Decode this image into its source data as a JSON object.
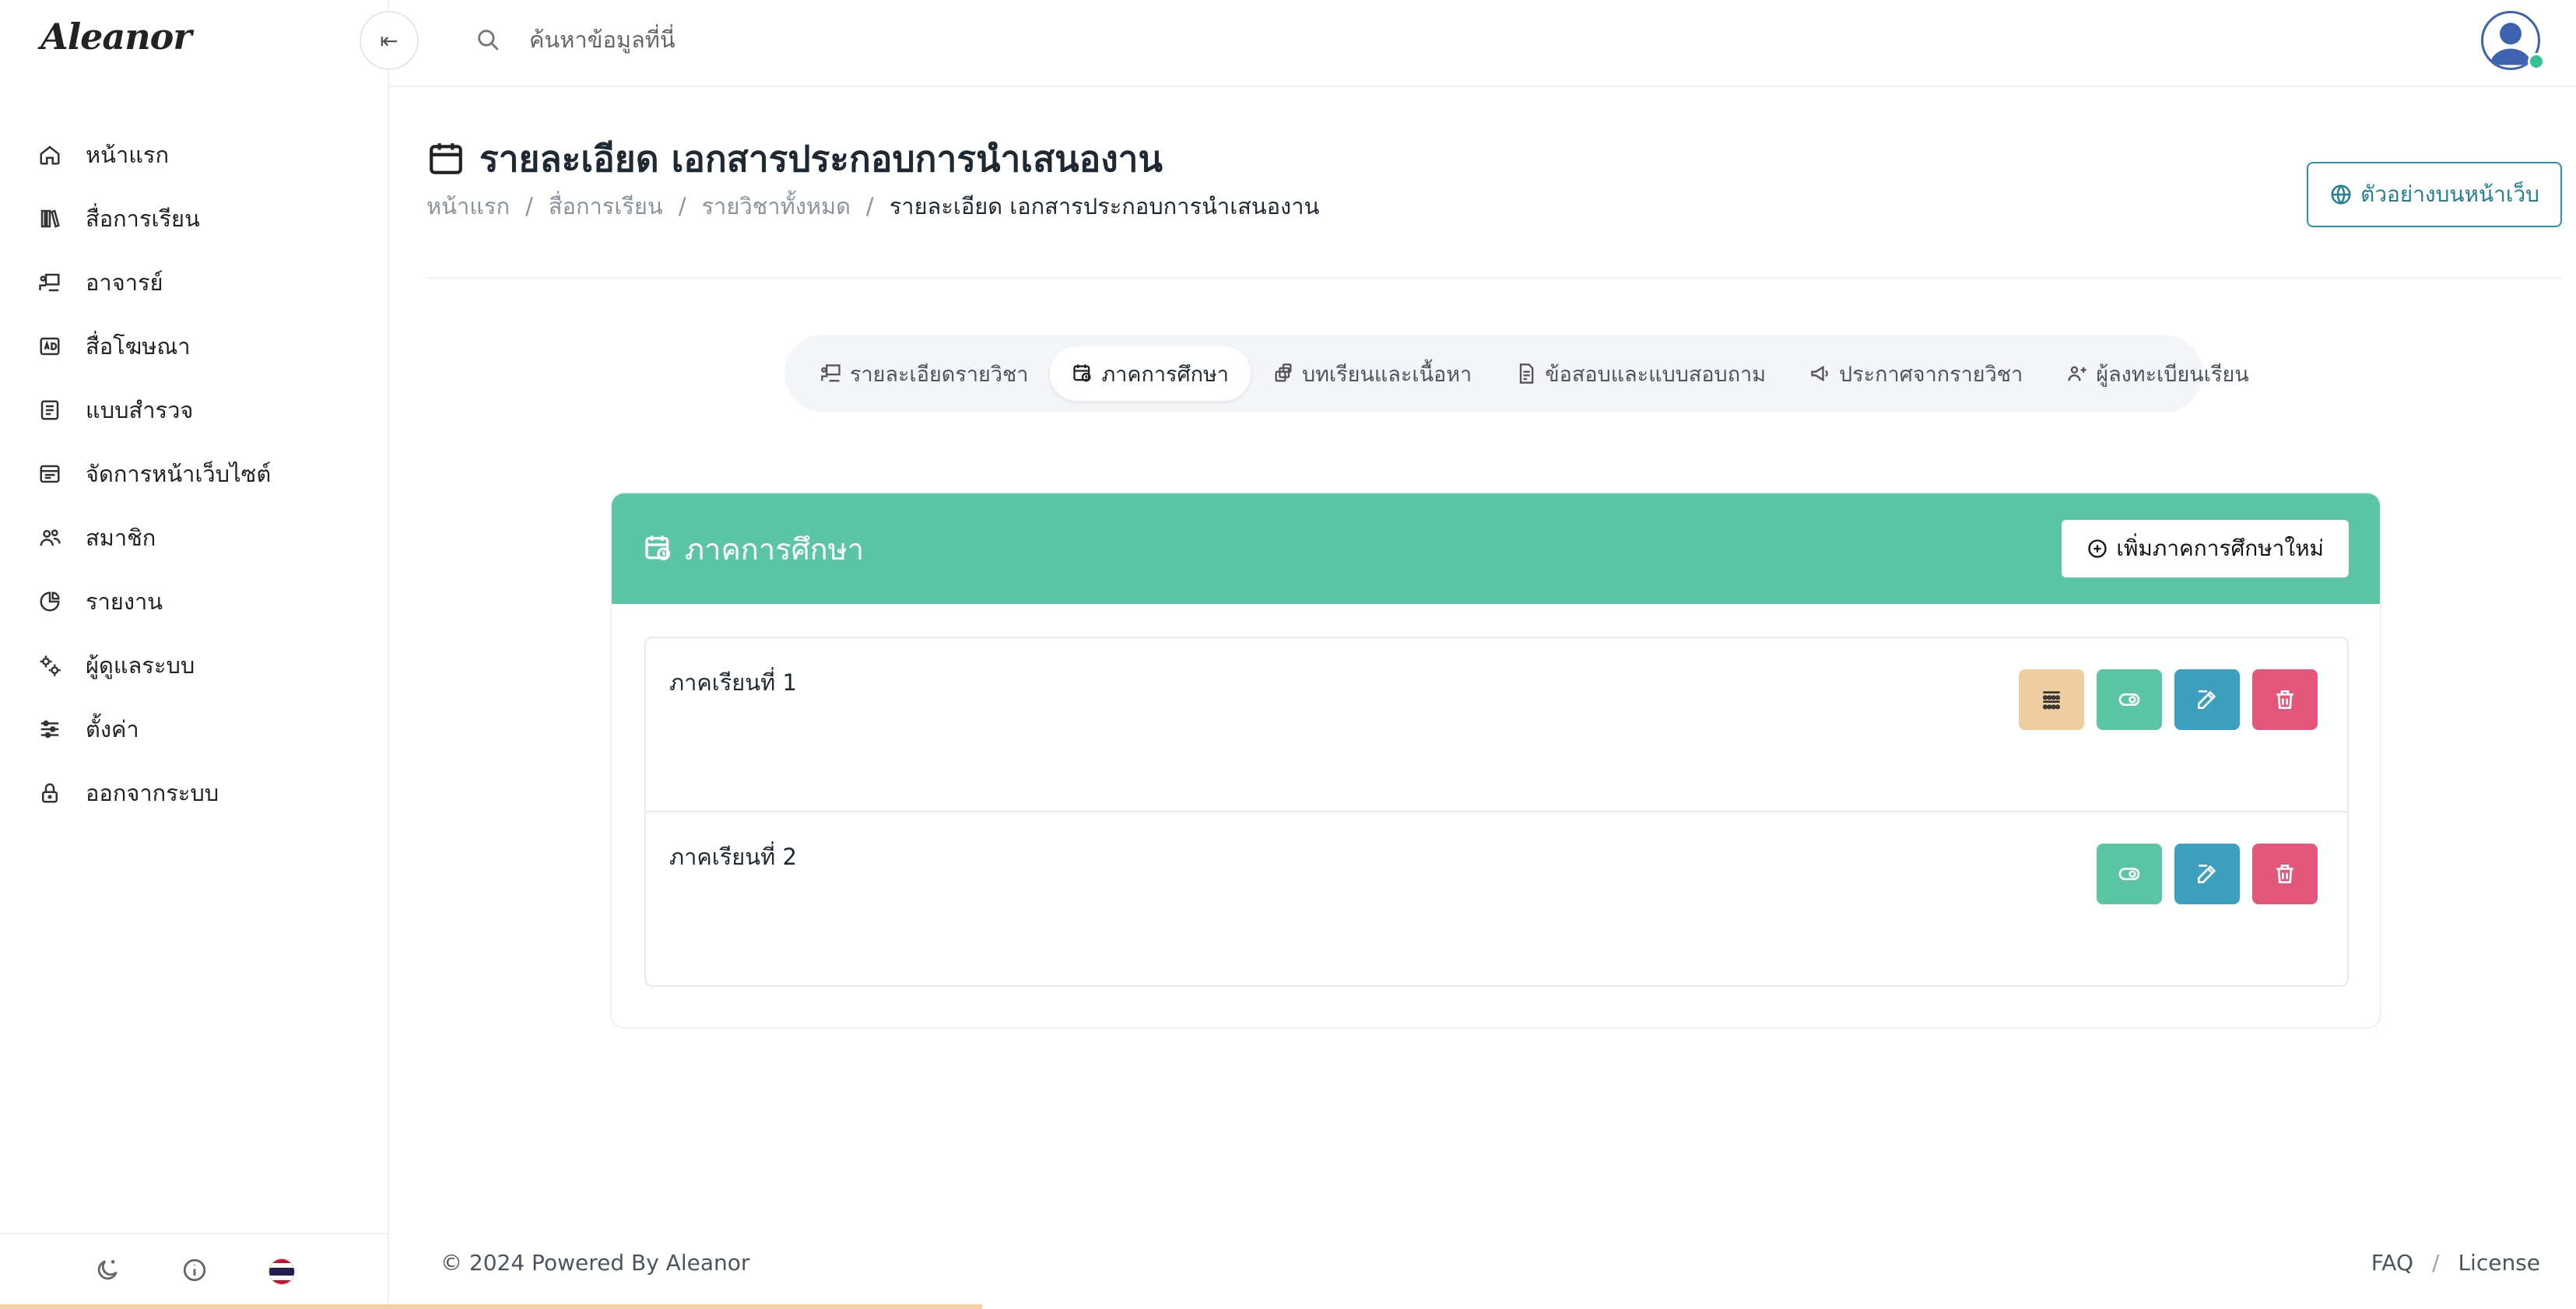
{
  "app": {
    "logo": "Aleanor",
    "collapse_icon": "collapse-left-icon"
  },
  "search": {
    "placeholder": "ค้นหาข้อมูลที่นี่",
    "value": ""
  },
  "sidebar": {
    "items": [
      {
        "label": "หน้าแรก",
        "icon": "home-icon"
      },
      {
        "label": "สื่อการเรียน",
        "icon": "books-icon"
      },
      {
        "label": "อาจารย์",
        "icon": "teacher-icon"
      },
      {
        "label": "สื่อโฆษณา",
        "icon": "ad-icon"
      },
      {
        "label": "แบบสำรวจ",
        "icon": "survey-icon"
      },
      {
        "label": "จัดการหน้าเว็บไซต์",
        "icon": "browser-icon"
      },
      {
        "label": "สมาชิก",
        "icon": "users-icon"
      },
      {
        "label": "รายงาน",
        "icon": "pie-chart-icon"
      },
      {
        "label": "ผู้ดูแลระบบ",
        "icon": "gears-icon"
      },
      {
        "label": "ตั้งค่า",
        "icon": "sliders-icon"
      },
      {
        "label": "ออกจากระบบ",
        "icon": "lock-icon"
      }
    ],
    "footer_icons": [
      "moon-icon",
      "info-icon",
      "thai-flag-icon"
    ]
  },
  "page": {
    "title": "รายละเอียด เอกสารประกอบการนำเสนองาน",
    "breadcrumb": [
      "หน้าแรก",
      "สื่อการเรียน",
      "รายวิชาทั้งหมด",
      "รายละเอียด เอกสารประกอบการนำเสนองาน"
    ],
    "preview_button": "ตัวอย่างบนหน้าเว็บ"
  },
  "tabs": [
    {
      "label": "รายละเอียดรายวิชา",
      "active": false
    },
    {
      "label": "ภาคการศึกษา",
      "active": true
    },
    {
      "label": "บทเรียนและเนื้อหา",
      "active": false
    },
    {
      "label": "ข้อสอบและแบบสอบถาม",
      "active": false
    },
    {
      "label": "ประกาศจากรายวิชา",
      "active": false
    },
    {
      "label": "ผู้ลงทะเบียนเรียน",
      "active": false
    }
  ],
  "card": {
    "title": "ภาคการศึกษา",
    "add_button": "เพิ่มภาคการศึกษาใหม่",
    "rows": [
      {
        "label": "ภาคเรียนที่ 1",
        "actions": [
          "grid",
          "view",
          "edit",
          "delete"
        ]
      },
      {
        "label": "ภาคเรียนที่ 2",
        "actions": [
          "view",
          "edit",
          "delete"
        ]
      }
    ]
  },
  "colors": {
    "accent_green": "#5cc6a4",
    "edit_blue": "#3ea0bf",
    "delete_red": "#e2577a",
    "grid_orange": "#f0cd9f",
    "outline_teal": "#2a93a8"
  },
  "footer": {
    "copyright": "© 2024 Powered By Aleanor",
    "links": [
      "FAQ",
      "License"
    ]
  }
}
